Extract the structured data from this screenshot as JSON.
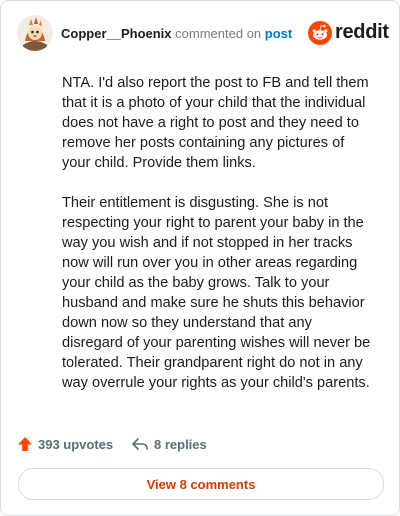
{
  "comment": {
    "username": "Copper__Phoenix",
    "action_text": "commented on",
    "post_link": "post",
    "avatar_icon": "phoenix-avatar-icon",
    "paragraphs": [
      "NTA. I'd also report the post to FB and tell them that it is a photo of your child that the individual does not have a right to post and they need to remove her posts containing any pictures of your child. Provide them links.",
      "Their entitlement is disgusting. She is not respecting your right to parent your baby in the way you wish and if not stopped in her tracks now will run over you in other areas regarding your child as the baby grows. Talk to your husband and make sure he shuts this behavior down now so they understand that any disregard of your parenting wishes will never be tolerated. Their grandparent right do not in any way overrule your rights as your child's parents."
    ]
  },
  "brand": {
    "wordmark": "reddit",
    "logo_icon": "reddit-logo-icon",
    "color": "#ff4500"
  },
  "actions": {
    "upvotes_label": "393 upvotes",
    "upvote_icon": "upvote-arrow-icon",
    "replies_label": "8 replies",
    "reply_icon": "reply-icon"
  },
  "view_comments": {
    "label": "View 8 comments",
    "color": "#d93a00"
  },
  "colors": {
    "username": "#1c1c1c",
    "muted": "#7c7c7c",
    "link": "#0079d3",
    "upvote": "#ff4500",
    "action_text": "#576f76"
  }
}
